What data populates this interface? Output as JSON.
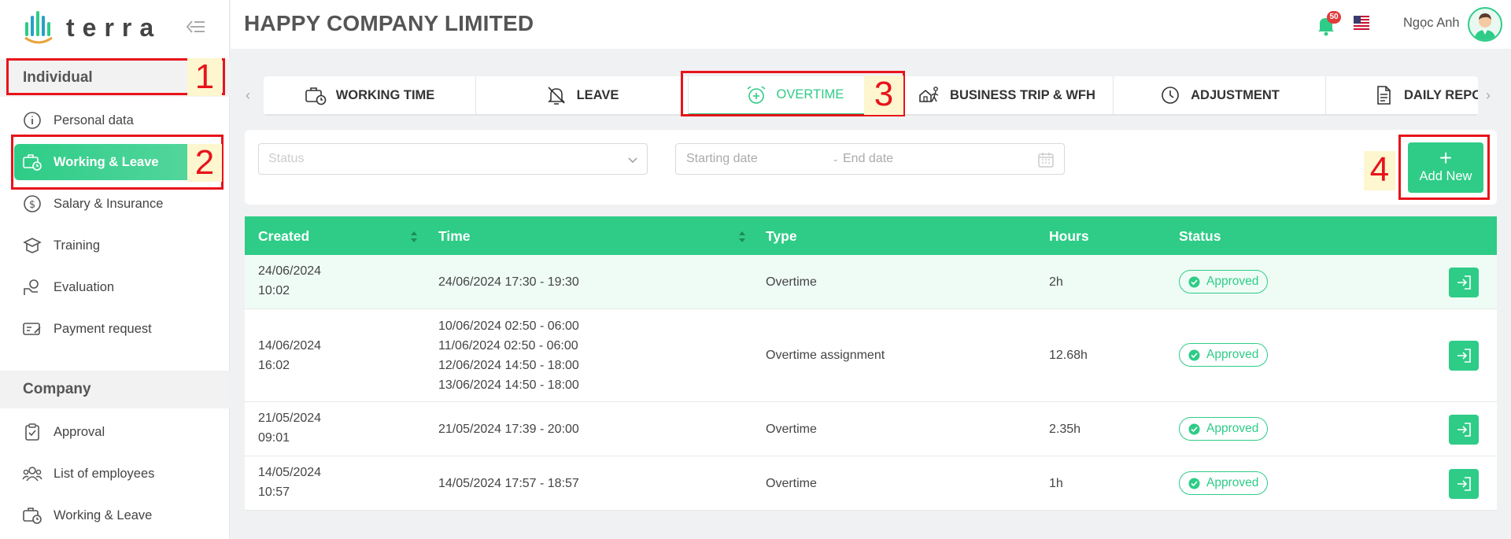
{
  "brand": {
    "name": "terra",
    "accent": "#2ecc87"
  },
  "sidebar": {
    "section_individual": "Individual",
    "section_company": "Company",
    "items": [
      {
        "label": "Personal data",
        "icon": "info-icon"
      },
      {
        "label": "Working & Leave",
        "icon": "briefcase-clock-icon",
        "active": true
      },
      {
        "label": "Salary & Insurance",
        "icon": "dollar-circle-icon"
      },
      {
        "label": "Training",
        "icon": "training-icon"
      },
      {
        "label": "Evaluation",
        "icon": "evaluation-icon"
      },
      {
        "label": "Payment request",
        "icon": "payment-icon"
      }
    ],
    "company_items": [
      {
        "label": "Approval",
        "icon": "clipboard-check-icon"
      },
      {
        "label": "List of employees",
        "icon": "people-icon"
      },
      {
        "label": "Working & Leave",
        "icon": "briefcase-clock-icon"
      }
    ]
  },
  "header": {
    "title": "HAPPY COMPANY LIMITED",
    "notification_count": "50",
    "user_name": "Ngọc Anh"
  },
  "tabs": [
    {
      "label": "WORKING TIME",
      "icon": "briefcase-clock-icon"
    },
    {
      "label": "LEAVE",
      "icon": "bell-off-icon"
    },
    {
      "label": "OVERTIME",
      "icon": "alarm-plus-icon",
      "active": true
    },
    {
      "label": "BUSINESS TRIP & WFH",
      "icon": "house-walk-icon"
    },
    {
      "label": "ADJUSTMENT",
      "icon": "clock-icon"
    },
    {
      "label": "DAILY REPOR",
      "icon": "document-icon"
    }
  ],
  "filters": {
    "status_placeholder": "Status",
    "start_placeholder": "Starting date",
    "end_placeholder": "End date",
    "separator": "-",
    "add_label": "Add New"
  },
  "table": {
    "columns": [
      "Created",
      "Time",
      "Type",
      "Hours",
      "Status"
    ],
    "rows": [
      {
        "created": [
          "24/06/2024",
          "10:02"
        ],
        "time": [
          "24/06/2024 17:30 - 19:30"
        ],
        "type": "Overtime",
        "hours": "2h",
        "status": "Approved"
      },
      {
        "created": [
          "14/06/2024",
          "16:02"
        ],
        "time": [
          "10/06/2024 02:50 - 06:00",
          "11/06/2024 02:50 - 06:00",
          "12/06/2024 14:50 - 18:00",
          "13/06/2024 14:50 - 18:00"
        ],
        "type": "Overtime assignment",
        "hours": "12.68h",
        "status": "Approved"
      },
      {
        "created": [
          "21/05/2024",
          "09:01"
        ],
        "time": [
          "21/05/2024 17:39 - 20:00"
        ],
        "type": "Overtime",
        "hours": "2.35h",
        "status": "Approved"
      },
      {
        "created": [
          "14/05/2024",
          "10:57"
        ],
        "time": [
          "14/05/2024 17:57 - 18:57"
        ],
        "type": "Overtime",
        "hours": "1h",
        "status": "Approved"
      }
    ]
  },
  "annotations": [
    "1",
    "2",
    "3",
    "4"
  ]
}
